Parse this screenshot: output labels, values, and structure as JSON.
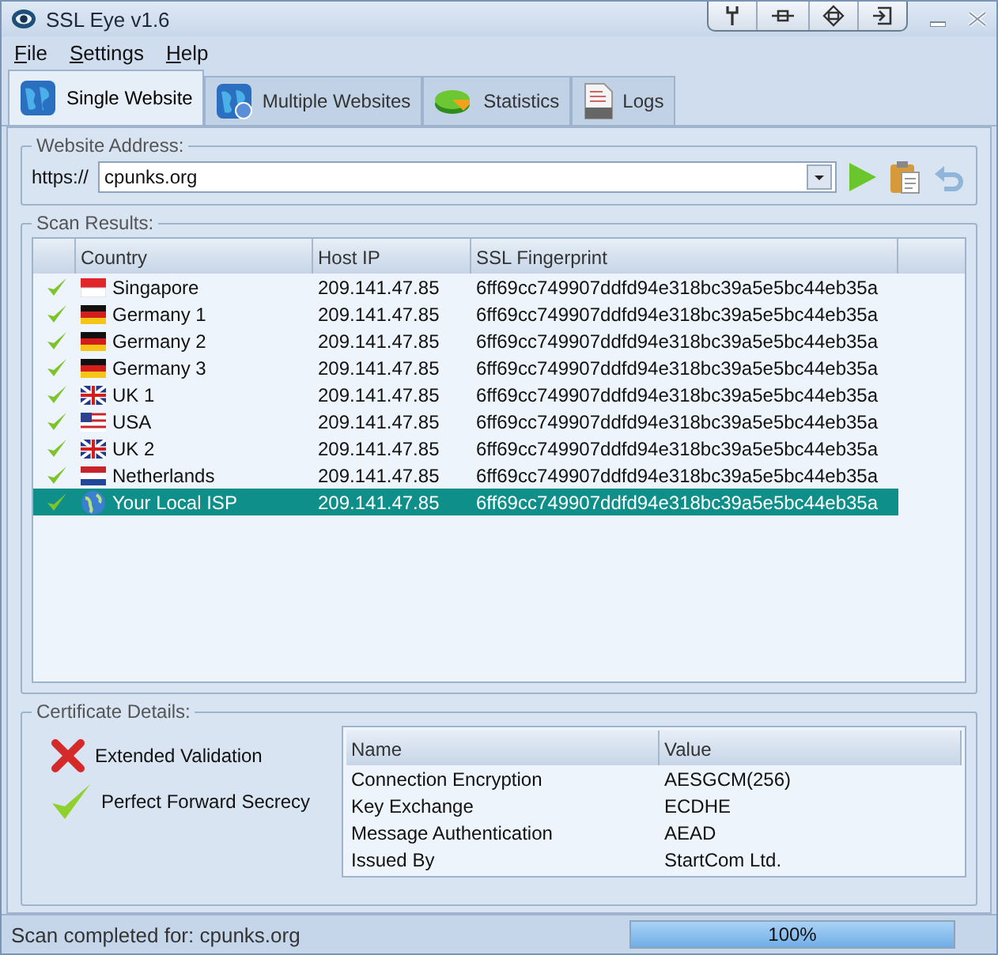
{
  "window": {
    "title": "SSL Eye v1.6"
  },
  "menu": [
    {
      "label": "File"
    },
    {
      "label": "Settings"
    },
    {
      "label": "Help"
    }
  ],
  "tabs": [
    {
      "label": "Single Website",
      "kind": "globe",
      "selected": true
    },
    {
      "label": "Multiple Websites",
      "kind": "globes",
      "selected": false
    },
    {
      "label": "Statistics",
      "kind": "pie",
      "selected": false
    },
    {
      "label": "Logs",
      "kind": "log",
      "selected": false
    }
  ],
  "website_address": {
    "title": "Website Address:",
    "prefix": "https://",
    "value": "cpunks.org"
  },
  "scan_results": {
    "title": "Scan Results:",
    "columns": [
      "Country",
      "Host IP",
      "SSL Fingerprint"
    ],
    "rows": [
      {
        "checked": true,
        "kind": "sg",
        "country": "Singapore",
        "ip": "209.141.47.85",
        "fingerprint": "6ff69cc749907ddfd94e318bc39a5e5bc44eb35a",
        "selected": false
      },
      {
        "checked": true,
        "kind": "de",
        "country": "Germany 1",
        "ip": "209.141.47.85",
        "fingerprint": "6ff69cc749907ddfd94e318bc39a5e5bc44eb35a",
        "selected": false
      },
      {
        "checked": true,
        "kind": "de",
        "country": "Germany 2",
        "ip": "209.141.47.85",
        "fingerprint": "6ff69cc749907ddfd94e318bc39a5e5bc44eb35a",
        "selected": false
      },
      {
        "checked": true,
        "kind": "de",
        "country": "Germany 3",
        "ip": "209.141.47.85",
        "fingerprint": "6ff69cc749907ddfd94e318bc39a5e5bc44eb35a",
        "selected": false
      },
      {
        "checked": true,
        "kind": "gb",
        "country": "UK 1",
        "ip": "209.141.47.85",
        "fingerprint": "6ff69cc749907ddfd94e318bc39a5e5bc44eb35a",
        "selected": false
      },
      {
        "checked": true,
        "kind": "us",
        "country": "USA",
        "ip": "209.141.47.85",
        "fingerprint": "6ff69cc749907ddfd94e318bc39a5e5bc44eb35a",
        "selected": false
      },
      {
        "checked": true,
        "kind": "gb",
        "country": "UK 2",
        "ip": "209.141.47.85",
        "fingerprint": "6ff69cc749907ddfd94e318bc39a5e5bc44eb35a",
        "selected": false
      },
      {
        "checked": true,
        "kind": "nl",
        "country": "Netherlands",
        "ip": "209.141.47.85",
        "fingerprint": "6ff69cc749907ddfd94e318bc39a5e5bc44eb35a",
        "selected": false
      },
      {
        "checked": true,
        "kind": "globe",
        "country": "Your Local ISP",
        "ip": "209.141.47.85",
        "fingerprint": "6ff69cc749907ddfd94e318bc39a5e5bc44eb35a",
        "selected": true
      }
    ]
  },
  "certificate_details": {
    "title": "Certificate Details:",
    "checks": [
      {
        "label": "Extended Validation",
        "passed": false
      },
      {
        "label": "Perfect Forward Secrecy",
        "passed": true
      }
    ],
    "columns": [
      "Name",
      "Value"
    ],
    "rows": [
      {
        "name": "Connection Encryption",
        "value": "AESGCM(256)"
      },
      {
        "name": "Key Exchange",
        "value": "ECDHE"
      },
      {
        "name": "Message Authentication",
        "value": "AEAD"
      },
      {
        "name": "Issued By",
        "value": "StartCom Ltd."
      }
    ]
  },
  "status_bar": {
    "text": "Scan completed for: cpunks.org",
    "progress_text": "100%",
    "level": 1
  }
}
